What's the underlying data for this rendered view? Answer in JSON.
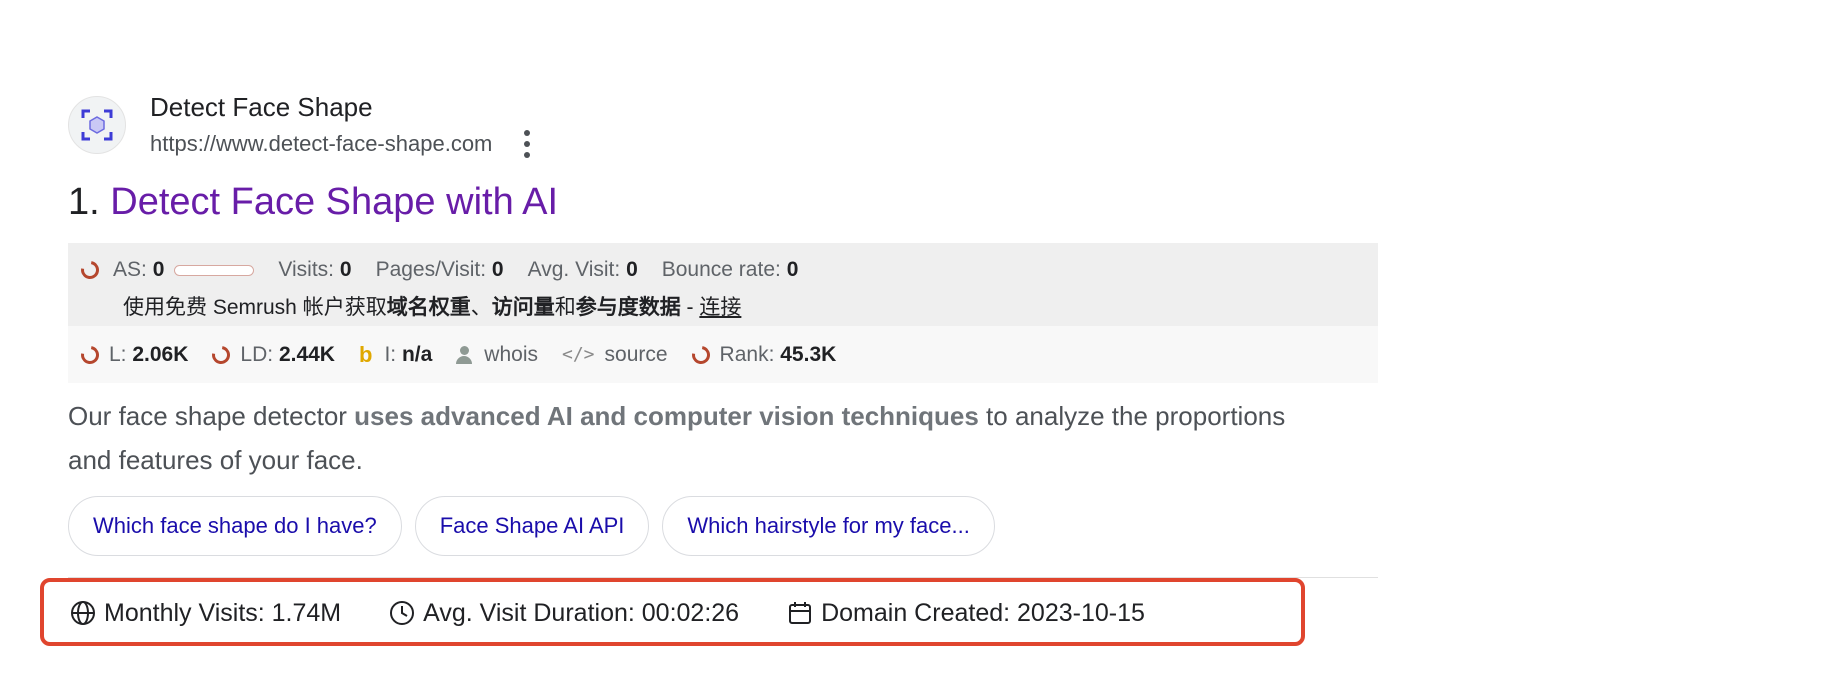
{
  "result": {
    "site_name": "Detect Face Shape",
    "url": "https://www.detect-face-shape.com",
    "rank_number": "1.",
    "title": "Detect Face Shape with AI"
  },
  "semrush": {
    "metrics": {
      "as_label": "AS:",
      "as_value": "0",
      "visits_label": "Visits:",
      "visits_value": "0",
      "pages_label": "Pages/Visit:",
      "pages_value": "0",
      "avg_label": "Avg. Visit:",
      "avg_value": "0",
      "bounce_label": "Bounce rate:",
      "bounce_value": "0"
    },
    "note": {
      "prefix": "使用免费 Semrush 帐户获取",
      "bold1": "域名权重",
      "sep1": "、",
      "bold2": "访问量",
      "sep2": "和",
      "bold3": "参与度数据",
      "dash": " - ",
      "link": "连接"
    },
    "bottom": {
      "l_label": "L:",
      "l_value": "2.06K",
      "ld_label": "LD:",
      "ld_value": "2.44K",
      "bing_glyph": "b",
      "i_label": "I:",
      "i_value": "n/a",
      "whois": "whois",
      "code_glyph": "</>",
      "source": "source",
      "rank_label": "Rank:",
      "rank_value": "45.3K"
    }
  },
  "snippet": {
    "part1": "Our face shape detector ",
    "bold": "uses advanced AI and computer vision techniques",
    "part2": " to analyze the proportions and features of your face."
  },
  "chips": [
    {
      "label": "Which face shape do I have?"
    },
    {
      "label": "Face Shape AI API"
    },
    {
      "label": "Which hairstyle for my face..."
    }
  ],
  "site_info": {
    "monthly_visits": "Monthly Visits: 1.74M",
    "avg_visit_duration": "Avg. Visit Duration: 00:02:26",
    "domain_created": "Domain Created: 2023-10-15"
  },
  "colors": {
    "title_link": "#681da8",
    "chip_text": "#1a0dab",
    "highlight_border": "#e0452e",
    "semrush_ring": "#b5472e"
  },
  "icons": [
    "face-scan-icon",
    "more-vert-icon",
    "semrush-ring-icon",
    "bing-icon",
    "person-icon",
    "code-icon",
    "globe-icon",
    "clock-icon",
    "calendar-icon"
  ]
}
